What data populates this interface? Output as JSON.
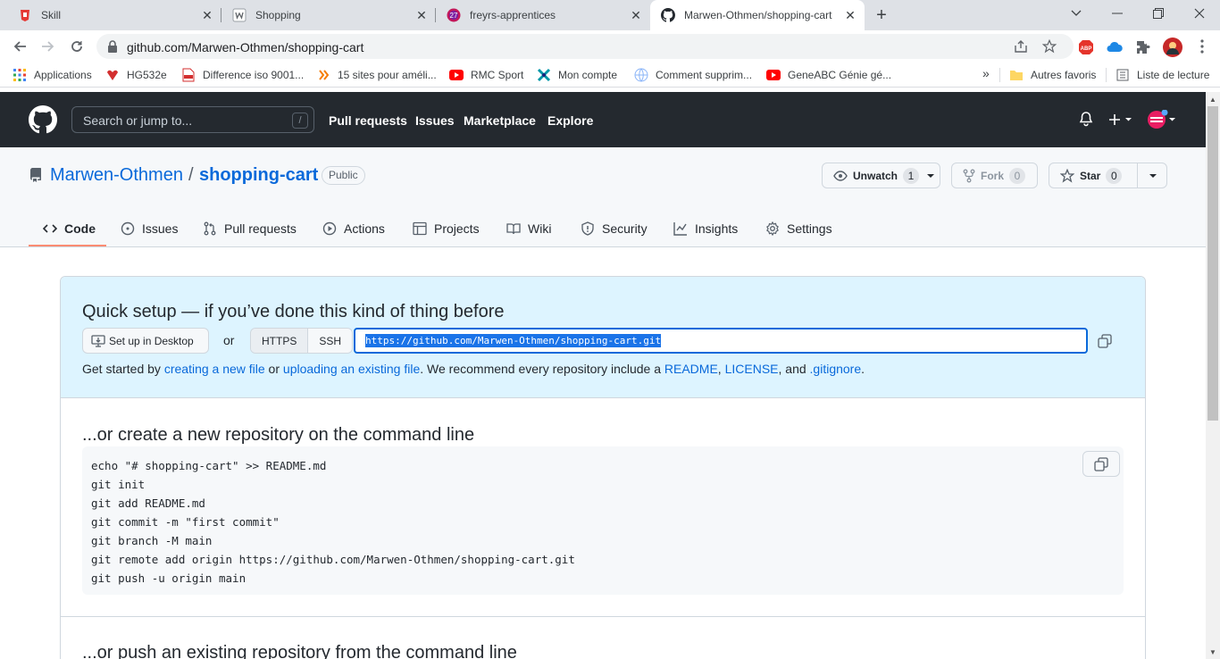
{
  "browser": {
    "tabs": [
      {
        "label": "Skill",
        "active": false
      },
      {
        "label": "Shopping",
        "active": false
      },
      {
        "label": "freyrs-apprentices",
        "active": false,
        "badge": "27"
      },
      {
        "label": "Marwen-Othmen/shopping-cart",
        "active": true
      }
    ],
    "url": "github.com/Marwen-Othmen/shopping-cart",
    "bookmarks": [
      "Applications",
      "HG532e",
      "Difference iso 9001...",
      "15 sites pour améli...",
      "RMC Sport",
      "Mon compte",
      "Comment supprim...",
      "GeneABC Génie gé..."
    ],
    "more_bookmarks": "»",
    "other_favorites": "Autres favoris",
    "reading_list": "Liste de lecture",
    "abp_label": "ABP"
  },
  "github": {
    "search_placeholder": "Search or jump to...",
    "search_shortcut": "/",
    "nav": [
      "Pull requests",
      "Issues",
      "Marketplace",
      "Explore"
    ]
  },
  "repo": {
    "owner": "Marwen-Othmen",
    "separator": "/",
    "name": "shopping-cart",
    "visibility": "Public",
    "watch": {
      "label": "Unwatch",
      "count": "1"
    },
    "fork": {
      "label": "Fork",
      "count": "0"
    },
    "star": {
      "label": "Star",
      "count": "0"
    },
    "tabs": [
      "Code",
      "Issues",
      "Pull requests",
      "Actions",
      "Projects",
      "Wiki",
      "Security",
      "Insights",
      "Settings"
    ],
    "selected_tab": "Code"
  },
  "quick_setup": {
    "title": "Quick setup — if you’ve done this kind of thing before",
    "desktop_button": "Set up in Desktop",
    "or": "or",
    "https": "HTTPS",
    "ssh": "SSH",
    "clone_url": "https://github.com/Marwen-Othmen/shopping-cart.git",
    "started": {
      "t1": "Get started by ",
      "link1": "creating a new file",
      "t2": " or ",
      "link2": "uploading an existing file",
      "t3": ". We recommend every repository include a ",
      "link3": "README",
      "t4": ", ",
      "link4": "LICENSE",
      "t5": ", and ",
      "link5": ".gitignore",
      "t6": "."
    }
  },
  "new_repo": {
    "title": "...or create a new repository on the command line",
    "lines": [
      "echo \"# shopping-cart\" >> README.md",
      "git init",
      "git add README.md",
      "git commit -m \"first commit\"",
      "git branch -M main",
      "git remote add origin https://github.com/Marwen-Othmen/shopping-cart.git",
      "git push -u origin main"
    ]
  },
  "push_existing": {
    "title": "...or push an existing repository from the command line"
  }
}
